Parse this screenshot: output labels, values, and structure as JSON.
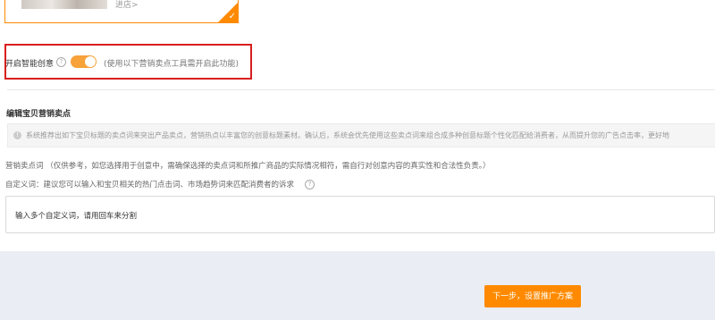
{
  "shop_card": {
    "enter_link": "进店>",
    "check_icon": "checkmark-icon",
    "accent_color": "#ff8a00"
  },
  "smart_creative": {
    "label": "开启智能创意",
    "help_icon": "question-circle-icon",
    "toggle_on": true,
    "toggle_color": "#f7a23a",
    "hint": "(使用以下营销卖点工具需开启此功能)",
    "highlight_color": "#d81e1e"
  },
  "edit_section": {
    "title": "编辑宝贝营销卖点",
    "notice_icon": "info-circle-icon",
    "notice": "系统推荐出如下宝贝标题的卖点词来突出产品卖点，营销热点以丰富您的创意标题素材。确认后，系统会优先使用这些卖点词来组合成多种创意标题个性化匹配给消费者，从而提升您的广告点击率，更好地",
    "sell_points_label": "营销卖点词 （仅供参考，如您选择用于创意中，需确保选择的卖点词和所推广商品的实际情况相符，需自行对创意内容的真实性和合法性负责。）",
    "custom_words_label": "自定义词：建议您可以输入和宝贝相关的热门点击词、市场趋势词来匹配消费者的诉求",
    "custom_words_help_icon": "question-circle-icon",
    "custom_words_placeholder": "输入多个自定义词，请用回车来分割"
  },
  "footer": {
    "next_button": "下一步，设置推广方案",
    "button_color": "#ff8a00"
  }
}
